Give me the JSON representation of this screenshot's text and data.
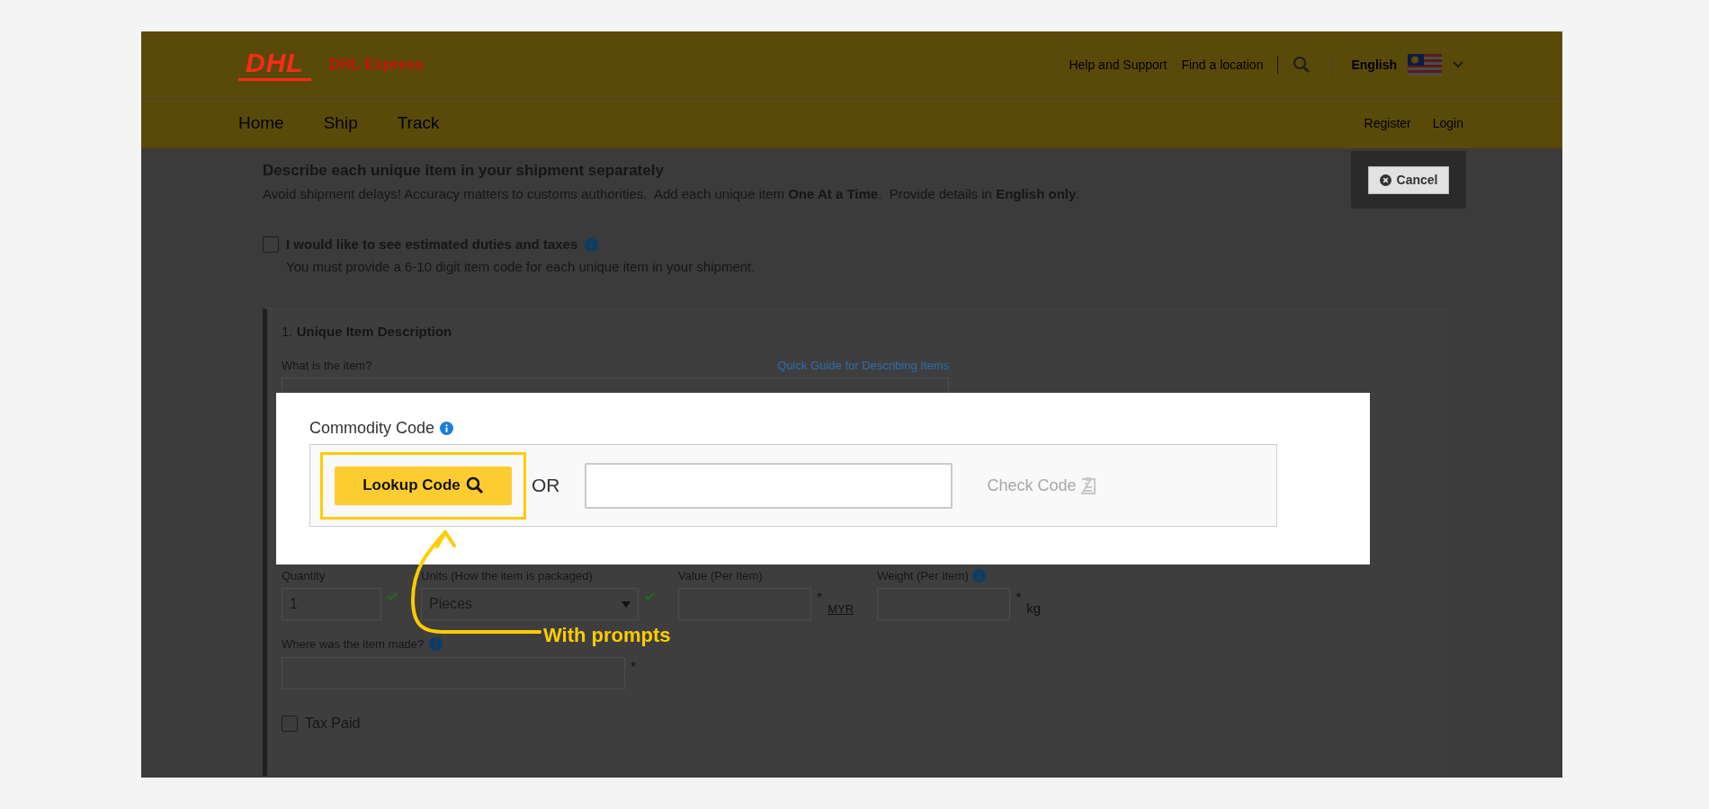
{
  "header": {
    "logo": "DHL",
    "brand": "DHL Express",
    "links": [
      "Help and Support",
      "Find a location"
    ],
    "language": "English"
  },
  "nav": {
    "items": [
      "Home",
      "Ship",
      "Track"
    ],
    "account": [
      "Register",
      "Login"
    ]
  },
  "cancel_button": "Cancel",
  "intro": {
    "title": "Describe each unique item in your shipment separately",
    "text": "Avoid shipment delays! Accuracy matters to customs authorities.  Add each unique item **One At a Time**.  Provide details in **English only**."
  },
  "duties": {
    "label": "I would like to see estimated duties and taxes",
    "checked": false,
    "note": "You must provide a 6-10 digit item code for each unique item in your shipment."
  },
  "item": {
    "number": "1.",
    "title": "Unique Item Description",
    "what_label": "What is the item?",
    "guide_link": "Quick Guide for Describing Items",
    "fields": [
      {
        "kind": "input",
        "label": "Quantity",
        "value": "1",
        "valid": true,
        "info": false
      },
      {
        "kind": "select",
        "label": "Units (How the item is packaged)",
        "value": "Pieces",
        "valid": true,
        "info": false
      },
      {
        "kind": "input",
        "label": "Value (Per Item)",
        "valid": false,
        "required": "*",
        "info": false,
        "unit": "MYR",
        "unit_link": true
      },
      {
        "kind": "input",
        "label": "Weight (Per Item)",
        "valid": false,
        "required": "*",
        "info": true,
        "unit": "kg",
        "unit_link": false
      }
    ],
    "origin": {
      "label": "Where was the item made?",
      "required": "*"
    },
    "tax_paid": {
      "label": "Tax Paid",
      "checked": false
    }
  },
  "spotlight": {
    "label": "Commodity Code",
    "lookup_button": "Lookup Code",
    "or": "OR",
    "check_button": "Check Code",
    "check_disabled": true
  },
  "callout": "With prompts"
}
